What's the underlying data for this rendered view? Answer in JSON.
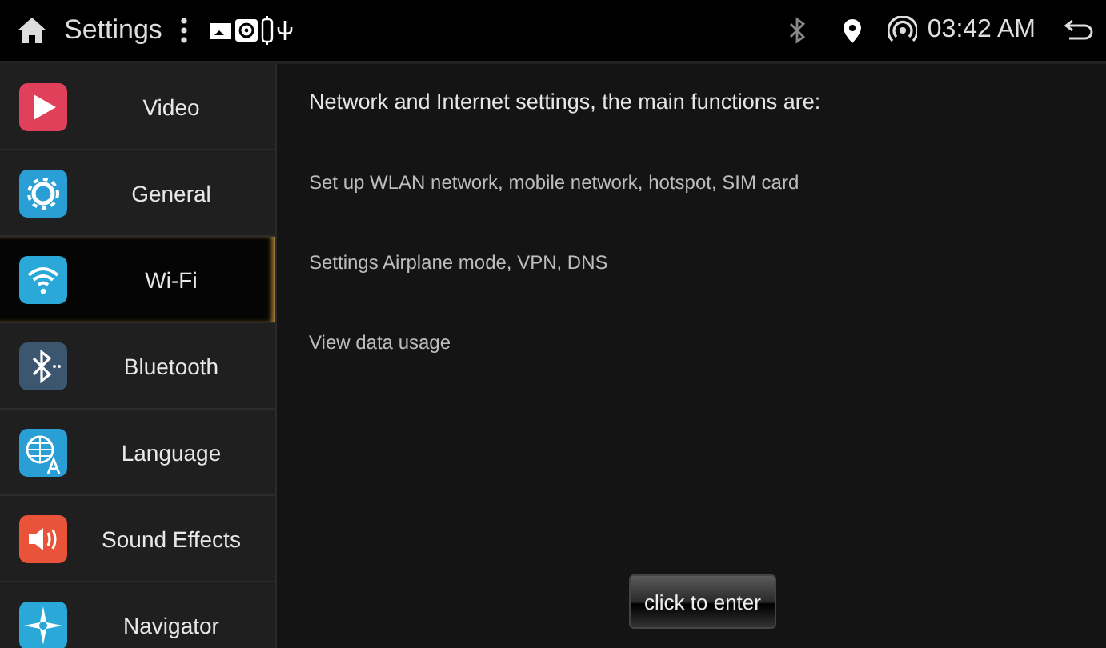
{
  "status_bar": {
    "title": "Settings",
    "time": "03:42 AM"
  },
  "sidebar": {
    "items": [
      {
        "label": "Video",
        "kind": "video",
        "color": "#e0405a",
        "selected": false
      },
      {
        "label": "General",
        "kind": "general",
        "color": "#2a9fd6",
        "selected": false
      },
      {
        "label": "Wi-Fi",
        "kind": "wifi",
        "color": "#2aa8d8",
        "selected": true
      },
      {
        "label": "Bluetooth",
        "kind": "bluetooth",
        "color": "#3d5670",
        "selected": false
      },
      {
        "label": "Language",
        "kind": "language",
        "color": "#2a9fd6",
        "selected": false
      },
      {
        "label": "Sound Effects",
        "kind": "sound",
        "color": "#e8533a",
        "selected": false
      },
      {
        "label": "Navigator",
        "kind": "navigator",
        "color": "#2aa8d8",
        "selected": false
      }
    ]
  },
  "content": {
    "heading": "Network and Internet settings, the main functions are:",
    "lines": [
      "Set up WLAN network, mobile network, hotspot, SIM card",
      "Settings Airplane mode, VPN, DNS",
      "View data usage"
    ],
    "button": "click to enter"
  }
}
